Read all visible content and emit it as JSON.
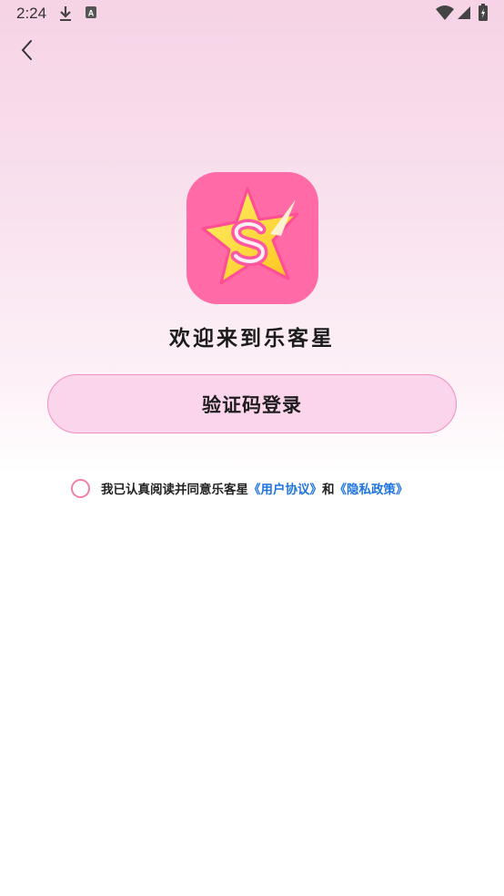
{
  "status_bar": {
    "time": "2:24",
    "icons": [
      "download-icon",
      "a-notification-icon",
      "wifi-icon",
      "signal-icon",
      "battery-icon"
    ]
  },
  "nav": {
    "back_icon": "chevron-left-icon"
  },
  "logo": {
    "icon": "star-s-logo",
    "colors": {
      "background": "#ff6aa7",
      "star": "#ffe33c"
    }
  },
  "welcome_text": "欢迎来到乐客星",
  "login_button": {
    "label": "验证码登录"
  },
  "agreement": {
    "prefix": "我已认真阅读并同意乐客星",
    "user_agreement": "《用户协议》",
    "and": "和",
    "privacy_policy": "《隐私政策》"
  },
  "colors": {
    "accent_pink": "#ef8fbf",
    "link_blue": "#1f74e0",
    "button_fill": "#fbd5ec"
  }
}
